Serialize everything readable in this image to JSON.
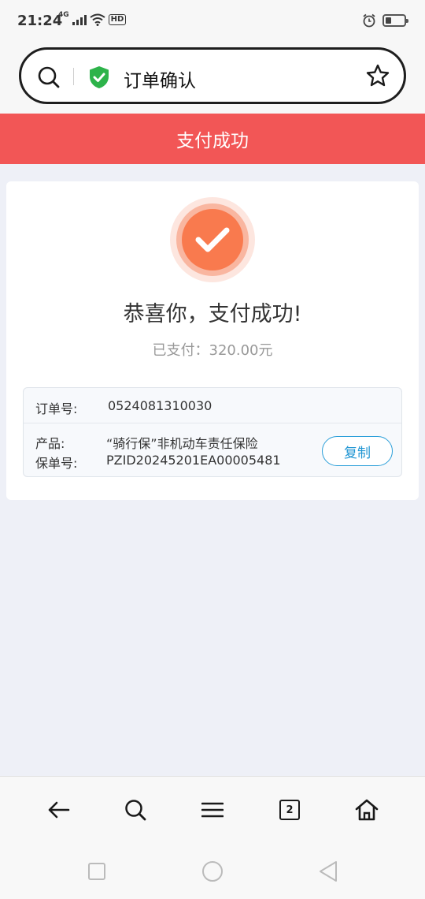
{
  "status_bar": {
    "time": "21:24",
    "network": "4G",
    "hd_label": "HD",
    "battery_level": 0.3
  },
  "address_bar": {
    "title": "订单确认"
  },
  "banner": {
    "text": "支付成功"
  },
  "card": {
    "title": "恭喜你，支付成功!",
    "paid_label": "已支付：",
    "paid_amount": "320.00元",
    "order_no_label": "订单号:",
    "order_no": "0524081310030",
    "product_label": "产品:",
    "product_value": "“骑行保”非机动车责任保险",
    "policy_label": "保单号:",
    "policy_value": "PZID20245201EA00005481",
    "copy_button": "复制"
  },
  "bottom_nav": {
    "tab_count": "2"
  },
  "colors": {
    "banner": "#f25656",
    "success": "#f97a4e",
    "link_blue": "#2196d3",
    "shield_green": "#2db34a"
  }
}
